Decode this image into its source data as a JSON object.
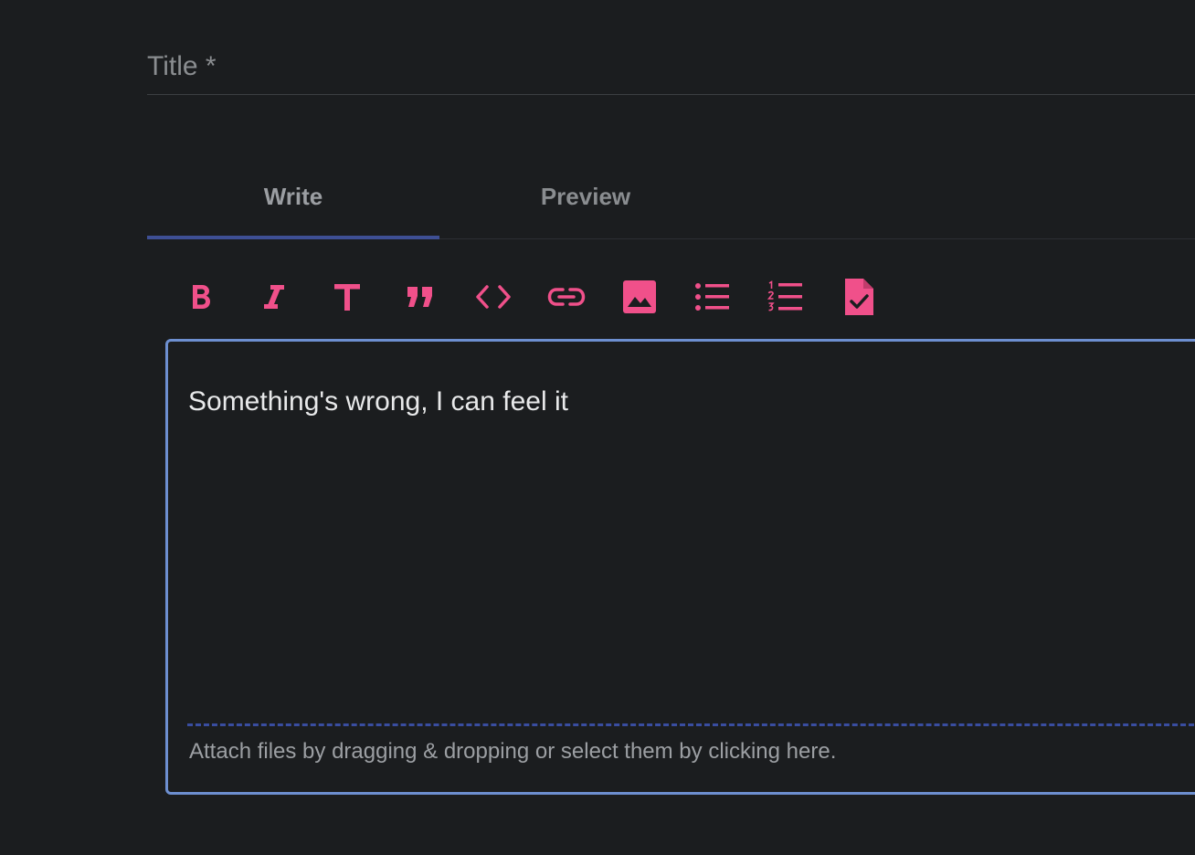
{
  "title_field": {
    "label": "Title *"
  },
  "tabs": [
    {
      "label": "Write",
      "active": true
    },
    {
      "label": "Preview",
      "active": false
    }
  ],
  "toolbar": {
    "icon_color": "#f0508a",
    "buttons": [
      {
        "name": "bold-icon"
      },
      {
        "name": "italic-icon"
      },
      {
        "name": "heading-icon"
      },
      {
        "name": "quote-icon"
      },
      {
        "name": "code-icon"
      },
      {
        "name": "link-icon"
      },
      {
        "name": "image-icon"
      },
      {
        "name": "bulleted-list-icon"
      },
      {
        "name": "numbered-list-icon"
      },
      {
        "name": "task-list-icon"
      }
    ]
  },
  "editor": {
    "text": "Something's wrong, I can feel it",
    "attach_hint": "Attach files by dragging & dropping or select them by clicking here."
  },
  "colors": {
    "background": "#1b1d1f",
    "accent": "#f0508a",
    "editor_border": "#6d8fd0",
    "tab_indicator": "#3e4f94"
  }
}
